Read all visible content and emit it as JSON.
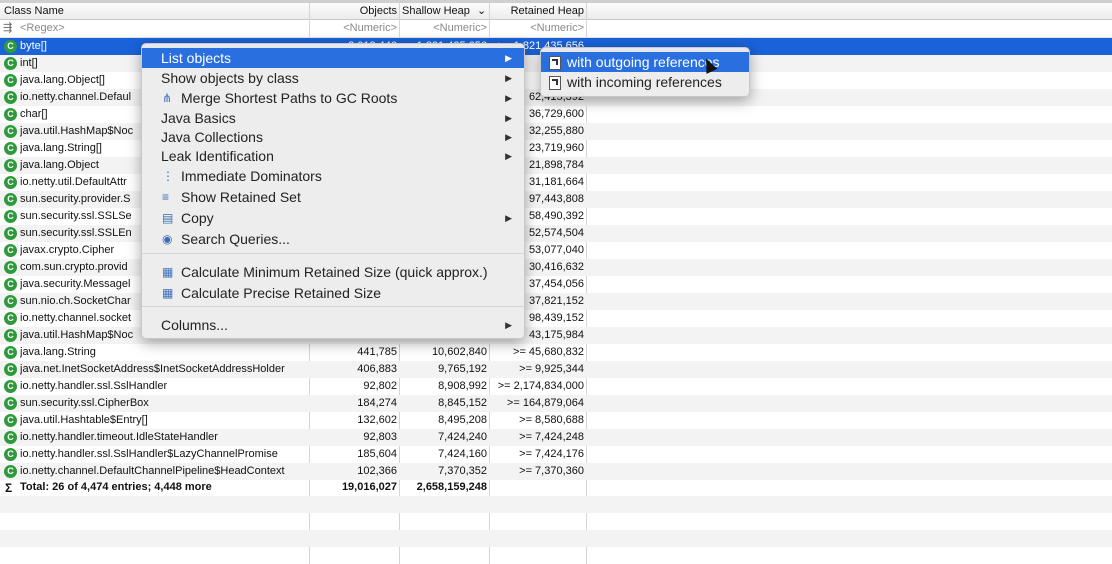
{
  "columns": {
    "name": "Class Name",
    "objects": "Objects",
    "shallow": "Shallow Heap",
    "retained": "Retained Heap",
    "sort_marker": "⌄"
  },
  "filter_row": {
    "name": "<Regex>",
    "objects": "<Numeric>",
    "shallow": "<Numeric>",
    "retained": "<Numeric>"
  },
  "rows": [
    {
      "name": "byte[]",
      "objects": "3,012,446",
      "shallow": "1,821,435,656",
      "retained": ">= 1,821,435,656"
    },
    {
      "name": "int[]",
      "objects": "",
      "shallow": "",
      "retained": ""
    },
    {
      "name": "java.lang.Object[]",
      "objects": "",
      "shallow": "",
      "retained": ""
    },
    {
      "name": "io.netty.channel.Defaul",
      "objects": "",
      "shallow": "",
      "retained": "62,415,392"
    },
    {
      "name": "char[]",
      "objects": "",
      "shallow": "",
      "retained": "36,729,600"
    },
    {
      "name": "java.util.HashMap$Noc",
      "objects": "",
      "shallow": "",
      "retained": "32,255,880"
    },
    {
      "name": "java.lang.String[]",
      "objects": "",
      "shallow": "",
      "retained": "23,719,960"
    },
    {
      "name": "java.lang.Object",
      "objects": "",
      "shallow": "",
      "retained": "21,898,784"
    },
    {
      "name": "io.netty.util.DefaultAttr",
      "objects": "",
      "shallow": "",
      "retained": "31,181,664"
    },
    {
      "name": "sun.security.provider.S",
      "objects": "",
      "shallow": "",
      "retained": "97,443,808"
    },
    {
      "name": "sun.security.ssl.SSLSe",
      "objects": "",
      "shallow": "",
      "retained": "58,490,392"
    },
    {
      "name": "sun.security.ssl.SSLEn",
      "objects": "",
      "shallow": "",
      "retained": "52,574,504"
    },
    {
      "name": "javax.crypto.Cipher",
      "objects": "",
      "shallow": "",
      "retained": "53,077,040"
    },
    {
      "name": "com.sun.crypto.provid",
      "objects": "",
      "shallow": "",
      "retained": "30,416,632"
    },
    {
      "name": "java.security.Messagel",
      "objects": "",
      "shallow": "",
      "retained": "37,454,056"
    },
    {
      "name": "sun.nio.ch.SocketChar",
      "objects": "",
      "shallow": "",
      "retained": "37,821,152"
    },
    {
      "name": "io.netty.channel.socket",
      "objects": "",
      "shallow": "",
      "retained": "98,439,152"
    },
    {
      "name": "java.util.HashMap$Noc",
      "objects": "",
      "shallow": "",
      "retained": "43,175,984"
    },
    {
      "name": "java.lang.String",
      "objects": "441,785",
      "shallow": "10,602,840",
      "retained": ">= 45,680,832"
    },
    {
      "name": "java.net.InetSocketAddress$InetSocketAddressHolder",
      "objects": "406,883",
      "shallow": "9,765,192",
      "retained": ">= 9,925,344"
    },
    {
      "name": "io.netty.handler.ssl.SslHandler",
      "objects": "92,802",
      "shallow": "8,908,992",
      "retained": ">= 2,174,834,000"
    },
    {
      "name": "sun.security.ssl.CipherBox",
      "objects": "184,274",
      "shallow": "8,845,152",
      "retained": ">= 164,879,064"
    },
    {
      "name": "java.util.Hashtable$Entry[]",
      "objects": "132,602",
      "shallow": "8,495,208",
      "retained": ">= 8,580,688"
    },
    {
      "name": "io.netty.handler.timeout.IdleStateHandler",
      "objects": "92,803",
      "shallow": "7,424,240",
      "retained": ">= 7,424,248"
    },
    {
      "name": "io.netty.handler.ssl.SslHandler$LazyChannelPromise",
      "objects": "185,604",
      "shallow": "7,424,160",
      "retained": ">= 7,424,176"
    },
    {
      "name": "io.netty.channel.DefaultChannelPipeline$HeadContext",
      "objects": "102,366",
      "shallow": "7,370,352",
      "retained": ">= 7,370,360"
    }
  ],
  "total": {
    "label": "Total: 26 of 4,474 entries; 4,448 more",
    "objects": "19,016,027",
    "shallow": "2,658,159,248"
  },
  "icons": {
    "class": "C",
    "sum": "Σ"
  },
  "context_menu": {
    "items": [
      {
        "label": "List objects",
        "submenu": true
      },
      {
        "label": "Show objects by class",
        "submenu": true
      },
      {
        "label": "Merge Shortest Paths to GC Roots",
        "submenu": true
      },
      {
        "label": "Java Basics",
        "submenu": true
      },
      {
        "label": "Java Collections",
        "submenu": true
      },
      {
        "label": "Leak Identification",
        "submenu": true
      },
      {
        "label": "Immediate Dominators",
        "submenu": false
      },
      {
        "label": "Show Retained Set",
        "submenu": false
      },
      {
        "label": "Copy",
        "submenu": true
      },
      {
        "label": "Search Queries...",
        "submenu": false
      },
      {
        "label": "Calculate Minimum Retained Size (quick approx.)",
        "submenu": false
      },
      {
        "label": "Calculate Precise Retained Size",
        "submenu": false
      },
      {
        "label": "Columns...",
        "submenu": true
      }
    ],
    "arrow": "▶"
  },
  "submenu": {
    "items": [
      {
        "label": "with outgoing references"
      },
      {
        "label": "with incoming references"
      }
    ]
  },
  "colors": {
    "selection": "#1a62d8",
    "class_icon": "#2f9a3b",
    "menu_highlight": "#2a6fe0"
  }
}
